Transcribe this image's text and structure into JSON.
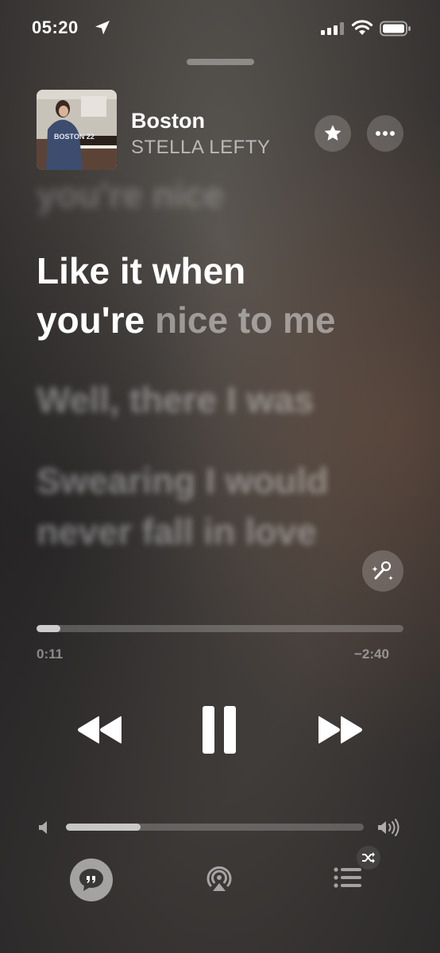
{
  "status_bar": {
    "time": "05:20",
    "icons": [
      "location-arrow-icon",
      "cellular-signal-icon",
      "wifi-icon",
      "battery-icon"
    ]
  },
  "now_playing": {
    "title": "Boston",
    "artist": "STELLA LEFTY",
    "artwork_jersey_text": "BOSTON 22"
  },
  "lyrics": {
    "previous_line": "you're nice",
    "current_line_1": "Like it when",
    "current_line_2_sung": "you're",
    "current_line_2_unsung": "nice to me",
    "next_line_1": "Well, there I was",
    "next_line_2a": "Swearing I would",
    "next_line_2b": "never fall in love"
  },
  "progress": {
    "elapsed": "0:11",
    "remaining": "−2:40",
    "fraction": 0.064
  },
  "volume": {
    "fraction": 0.25
  },
  "colors": {
    "accent": "#ffffff",
    "background": "#46423f"
  }
}
